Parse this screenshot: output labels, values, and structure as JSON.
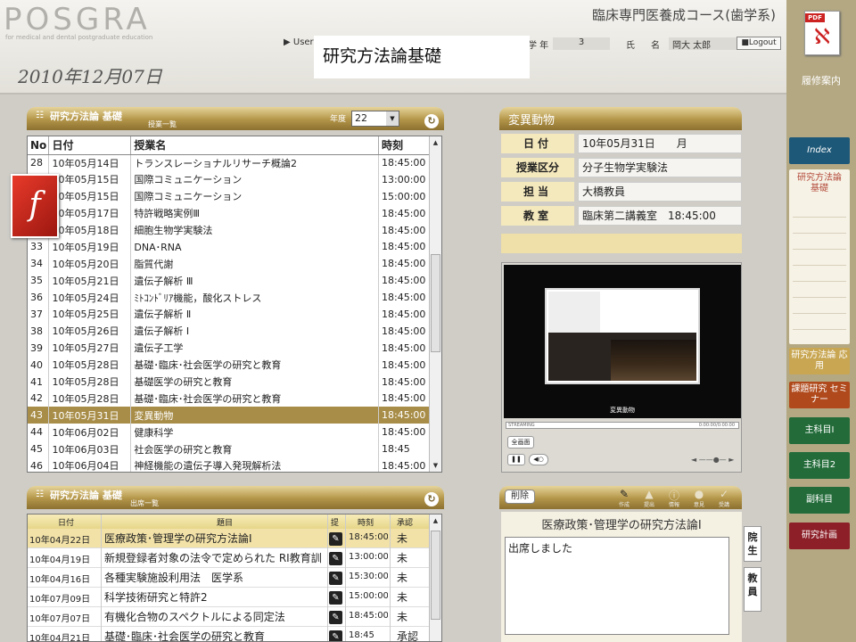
{
  "header": {
    "logo": "POSGRA",
    "logo_sub": "for medical and dental postgraduate education",
    "course": "臨床専門医養成コース(歯学系)",
    "user_label": "▶ User",
    "grade_label": "学 年",
    "grade_value": "3",
    "name_label": "氏",
    "name_label2": "名",
    "name_value": "岡大 太郎",
    "logout": "■Logout",
    "overlay_title": "研究方法論基礎",
    "date": "2010年12月07日"
  },
  "rail": {
    "pdf_tag": "PDF",
    "rishu": "履修案内",
    "index": "Index",
    "active": "研究方法論 基礎",
    "ouyou": "研究方法論 応用",
    "kadai": "課題研究 セミナー",
    "shu1": "主科目Ⅰ",
    "shu2": "主科目2",
    "fuku": "副科目",
    "plan": "研究計画"
  },
  "lessons": {
    "title": "研究方法論 基礎",
    "subtitle": "授業一覧",
    "year_label": "年度",
    "year_value": "22",
    "columns": [
      "No",
      "日付",
      "授業名",
      "時刻"
    ],
    "rows": [
      [
        "28",
        "10年05月14日",
        "トランスレーショナルリサーチ概論2",
        "18:45:00"
      ],
      [
        "29",
        "10年05月15日",
        "国際コミュニケーション",
        "13:00:00"
      ],
      [
        "30",
        "10年05月15日",
        "国際コミュニケーション",
        "15:00:00"
      ],
      [
        "31",
        "10年05月17日",
        "特許戦略実例Ⅲ",
        "18:45:00"
      ],
      [
        "32",
        "10年05月18日",
        "細胞生物学実験法",
        "18:45:00"
      ],
      [
        "33",
        "10年05月19日",
        "DNA･RNA",
        "18:45:00"
      ],
      [
        "34",
        "10年05月20日",
        "脂質代謝",
        "18:45:00"
      ],
      [
        "35",
        "10年05月21日",
        "遺伝子解析 Ⅲ",
        "18:45:00"
      ],
      [
        "36",
        "10年05月24日",
        "ﾐﾄｺﾝﾄﾞﾘｱ機能，酸化ストレス",
        "18:45:00"
      ],
      [
        "37",
        "10年05月25日",
        "遺伝子解析 Ⅱ",
        "18:45:00"
      ],
      [
        "38",
        "10年05月26日",
        "遺伝子解析 Ⅰ",
        "18:45:00"
      ],
      [
        "39",
        "10年05月27日",
        "遺伝子工学",
        "18:45:00"
      ],
      [
        "40",
        "10年05月28日",
        "基礎･臨床･社会医学の研究と教育",
        "18:45:00"
      ],
      [
        "41",
        "10年05月28日",
        "基礎医学の研究と教育",
        "18:45:00"
      ],
      [
        "42",
        "10年05月28日",
        "基礎･臨床･社会医学の研究と教育",
        "18:45:00"
      ],
      [
        "43",
        "10年05月31日",
        "変異動物",
        "18:45:00"
      ],
      [
        "44",
        "10年06月02日",
        "健康科学",
        "18:45:00"
      ],
      [
        "45",
        "10年06月03日",
        "社会医学の研究と教育",
        "18:45"
      ],
      [
        "46",
        "10年06月04日",
        "神経機能の遺伝子導入発現解析法",
        "18:45:00"
      ]
    ]
  },
  "attendance": {
    "title": "研究方法論 基礎",
    "subtitle": "出席一覧",
    "columns": [
      "日付",
      "題目",
      "提",
      "時刻",
      "承認"
    ],
    "rows": [
      [
        "10年04月22日",
        "医療政策･管理学の研究方法論Ⅰ",
        "18:45:00",
        "未"
      ],
      [
        "10年04月19日",
        "新規登録者対象の法令で定められた RI教育訓",
        "13:00:00",
        "未"
      ],
      [
        "10年04月16日",
        "各種実験施設利用法　医学系",
        "15:30:00",
        "未"
      ],
      [
        "10年07月09日",
        "科学技術研究と特許2",
        "15:00:00",
        "未"
      ],
      [
        "10年07月07日",
        "有機化合物のスペクトルによる同定法",
        "18:45:00",
        "未"
      ],
      [
        "10年04月21日",
        "基礎･臨床･社会医学の研究と教育",
        "18:45",
        "承認"
      ]
    ]
  },
  "detail": {
    "title": "変異動物",
    "date_label": "日付",
    "date_value": "10年05月31日　　月",
    "kubun_label": "授業区分",
    "kubun_value": "分子生物学実験法",
    "tanto_label": "担当",
    "tanto_value": "大橋教員",
    "room_label": "教室",
    "room_value": "臨床第二講義室　18:45:00"
  },
  "player": {
    "caption": "変異動物",
    "seek_start": "STREAMING",
    "seek_time": "0:00:00/0:00:00",
    "fullscreen": "全画面"
  },
  "comment": {
    "delete": "削除",
    "tools": [
      "作成",
      "提出",
      "情報",
      "意見",
      "受講"
    ],
    "title": "医療政策･管理学の研究方法論Ⅰ",
    "text": "出席しました",
    "tab_student": "院生",
    "tab_teacher": "教員"
  }
}
